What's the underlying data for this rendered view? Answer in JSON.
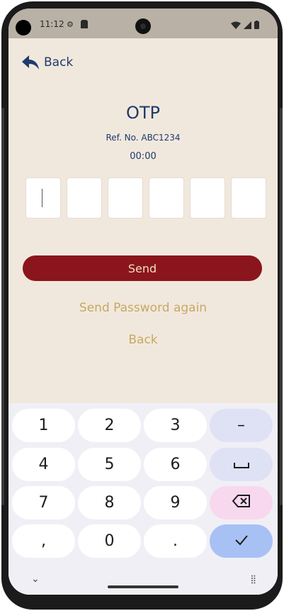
{
  "status_bar": {
    "time": "11:12",
    "icons_left": [
      "settings-icon",
      "sim-icon"
    ],
    "icons_right": [
      "wifi-icon",
      "signal-icon",
      "battery-icon"
    ]
  },
  "header": {
    "back_label": "Back"
  },
  "otp": {
    "title": "OTP",
    "reference": "Ref. No. ABC1234",
    "timer": "00:00",
    "digits": [
      "",
      "",
      "",
      "",
      "",
      ""
    ]
  },
  "actions": {
    "send_label": "Send",
    "resend_label": "Send Password again",
    "back_label": "Back"
  },
  "keyboard": {
    "rows": [
      [
        "1",
        "2",
        "3",
        "–"
      ],
      [
        "4",
        "5",
        "6",
        "␣"
      ],
      [
        "7",
        "8",
        "9",
        "⌫"
      ],
      [
        ",",
        "0",
        ".",
        "✓"
      ]
    ]
  },
  "colors": {
    "background": "#f1e8dd",
    "primary_text": "#1f3a6b",
    "send_button": "#8b151d",
    "link": "#c8a862"
  }
}
